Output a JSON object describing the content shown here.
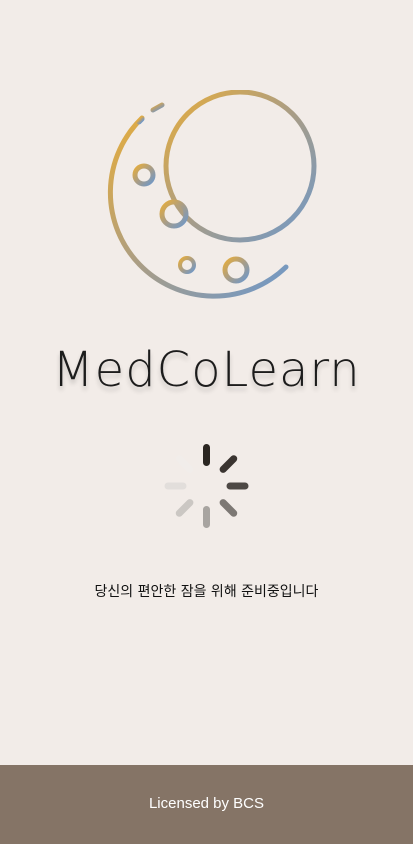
{
  "app": {
    "title": "MedCoLearn",
    "logo_icon": "moon-globe-logo-icon",
    "loading_icon": "loading-spinner-icon"
  },
  "loading": {
    "message": "당신의 편안한 잠을 위해 준비중입니다"
  },
  "footer": {
    "license": "Licensed by BCS"
  },
  "colors": {
    "background": "#f2ece8",
    "footer_background": "#857466",
    "gradient_gold": "#e6ad3c",
    "gradient_blue": "#6f98c9",
    "text": "#111111"
  }
}
